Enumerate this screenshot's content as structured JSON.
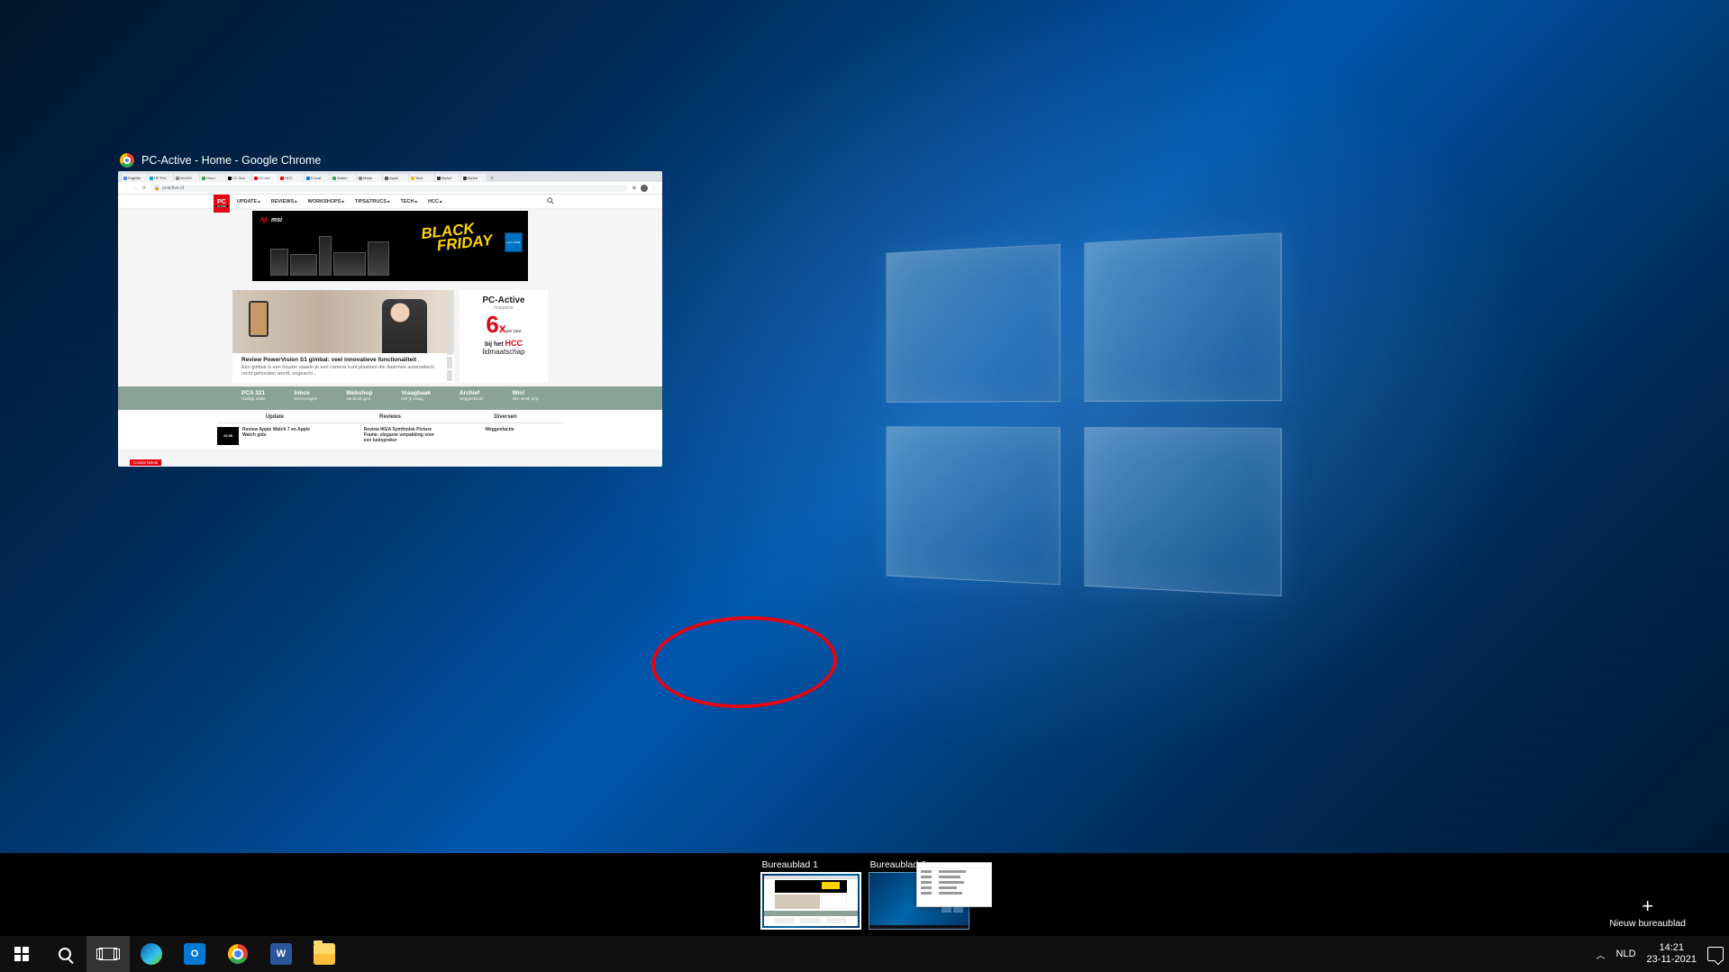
{
  "window": {
    "title": "PC-Active - Home - Google Chrome",
    "url_host": "pcactive.nl"
  },
  "tabs": [
    {
      "label": "Pagefile",
      "color": "#4285f4"
    },
    {
      "label": "HP Prin",
      "color": "#0096d6"
    },
    {
      "label": "WL500",
      "color": "#888"
    },
    {
      "label": "How-t",
      "color": "#34a853"
    },
    {
      "label": "CC Sec",
      "color": "#000"
    },
    {
      "label": "PC-Act",
      "color": "#e30613",
      "active": true
    },
    {
      "label": "HCC",
      "color": "#e30613"
    },
    {
      "label": "E-mail",
      "color": "#0078d4"
    },
    {
      "label": "Webm",
      "color": "#34a853"
    },
    {
      "label": "Maak",
      "color": "#888"
    },
    {
      "label": "Apple",
      "color": "#555"
    },
    {
      "label": "Tech",
      "color": "#fbbc05"
    },
    {
      "label": "MyAct",
      "color": "#333"
    },
    {
      "label": "MyAct",
      "color": "#333"
    }
  ],
  "site": {
    "logo_top": "PC",
    "logo_sub": "ACTIVE",
    "nav": [
      "UPDATE",
      "REVIEWS",
      "WORKSHOPS",
      "TIPS&TRUCS",
      "TECH",
      "HCC"
    ],
    "banner": {
      "brand": "msi",
      "headline1": "BLACK",
      "headline2": "FRIDAY",
      "badge": "intel CORE"
    },
    "hero": {
      "title": "Review PowerVision S1 gimbal: veel innovatieve functionaliteit",
      "sub": "Een gimbal is een houder waarin je een camera kunt plaatsen die daarmee automatisch recht gehouden wordt, ongeacht..."
    },
    "sidebar_ad": {
      "title": "PC-Active",
      "mag": "magazine",
      "six": "6",
      "x": "x",
      "perjaar": "per jaar",
      "bij": "bij het",
      "hcc": "HCC",
      "lid": "lidmaatschap"
    },
    "greenbar": [
      {
        "title": "PCA 321",
        "sub": "huidige editie"
      },
      {
        "title": "Inbox",
        "sub": "lezersvragen"
      },
      {
        "title": "Webshop",
        "sub": "aanbiedingen"
      },
      {
        "title": "Vraagbaak",
        "sub": "stel je vraag"
      },
      {
        "title": "Archief",
        "sub": "weggeefactie"
      },
      {
        "title": "Win!",
        "sub": "elke week prijs"
      }
    ],
    "cols": [
      "Update",
      "Reviews",
      "Diversen"
    ],
    "articles": [
      {
        "img": "10:09",
        "text": "Review Apple Watch 7 en Apple Watch gids"
      },
      {
        "img": "",
        "text": "Review IKEA Symfonisk Picture Frame: elegante verpakking voor een luidspreker"
      },
      {
        "img": "",
        "text": "Weggeefactie"
      }
    ],
    "cookie": "Cookie beleid"
  },
  "virtual_desktops": {
    "d1": "Bureaublad 1",
    "d2": "Bureaublad 2",
    "new": "Nieuw bureaublad"
  },
  "taskbar": {
    "outlook": "O",
    "word": "W",
    "lang": "NLD",
    "time": "14:21",
    "date": "23-11-2021"
  }
}
